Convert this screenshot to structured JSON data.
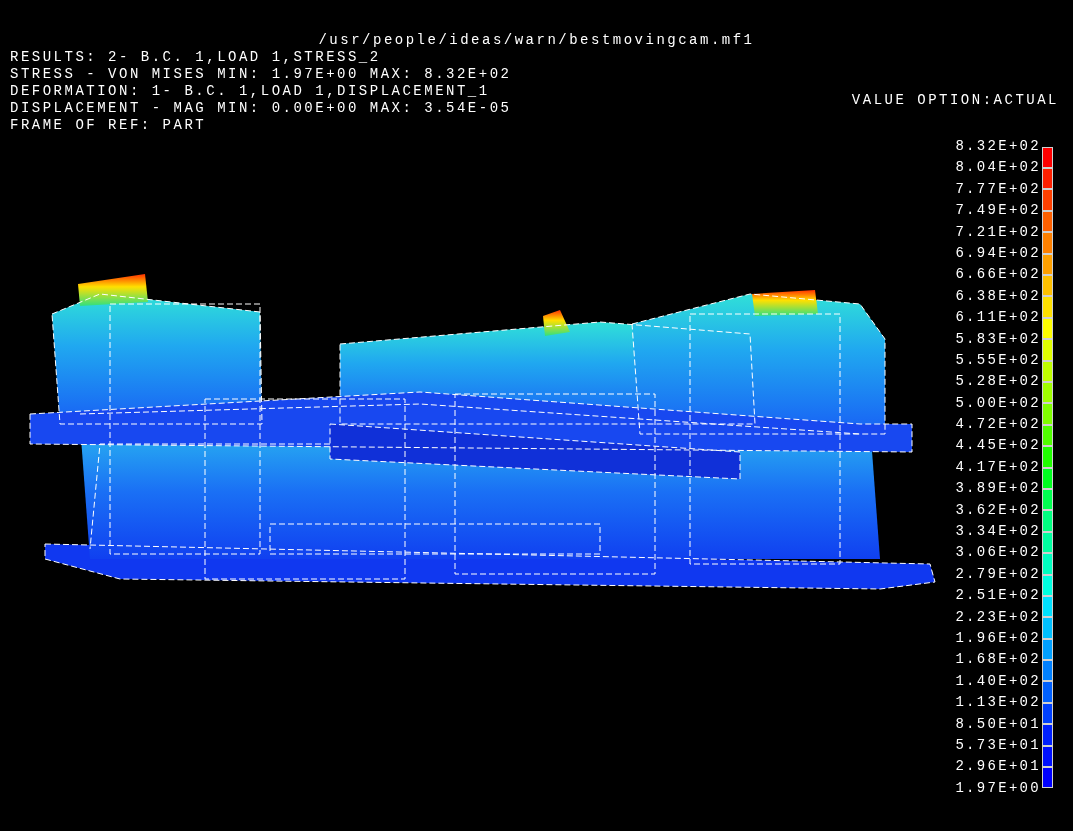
{
  "window": {
    "title": "/usr/people/ideas/warn/bestmovingcam.mf1"
  },
  "info_lines": [
    "RESULTS: 2- B.C. 1,LOAD 1,STRESS_2",
    "STRESS - VON MISES MIN: 1.97E+00 MAX: 8.32E+02",
    "DEFORMATION: 1- B.C. 1,LOAD 1,DISPLACEMENT_1",
    "DISPLACEMENT - MAG MIN: 0.00E+00 MAX: 3.54E-05",
    "FRAME OF REF: PART"
  ],
  "value_option": "VALUE OPTION:ACTUAL",
  "legend": {
    "labels": [
      "8.32E+02",
      "8.04E+02",
      "7.77E+02",
      "7.49E+02",
      "7.21E+02",
      "6.94E+02",
      "6.66E+02",
      "6.38E+02",
      "6.11E+02",
      "5.83E+02",
      "5.55E+02",
      "5.28E+02",
      "5.00E+02",
      "4.72E+02",
      "4.45E+02",
      "4.17E+02",
      "3.89E+02",
      "3.62E+02",
      "3.34E+02",
      "3.06E+02",
      "2.79E+02",
      "2.51E+02",
      "2.23E+02",
      "1.96E+02",
      "1.68E+02",
      "1.40E+02",
      "1.13E+02",
      "8.50E+01",
      "5.73E+01",
      "2.96E+01",
      "1.97E+00"
    ],
    "bands": [
      {
        "color": "#ff0000"
      },
      {
        "color": "#ff2000"
      },
      {
        "color": "#ff4000"
      },
      {
        "color": "#ff6000"
      },
      {
        "color": "#ff8000"
      },
      {
        "color": "#ffa000"
      },
      {
        "color": "#ffc000"
      },
      {
        "color": "#ffe000"
      },
      {
        "color": "#ffff00"
      },
      {
        "color": "#e0ff00"
      },
      {
        "color": "#c0ff00"
      },
      {
        "color": "#a0ff00"
      },
      {
        "color": "#80ff00"
      },
      {
        "color": "#50ff00"
      },
      {
        "color": "#20ff00"
      },
      {
        "color": "#00ff20"
      },
      {
        "color": "#00ff50"
      },
      {
        "color": "#00ff80"
      },
      {
        "color": "#00ffa0"
      },
      {
        "color": "#00ffc0"
      },
      {
        "color": "#00ffe0"
      },
      {
        "color": "#00e0ff"
      },
      {
        "color": "#00c0ff"
      },
      {
        "color": "#00a0ff"
      },
      {
        "color": "#0080ff"
      },
      {
        "color": "#0060ff"
      },
      {
        "color": "#0040ff"
      },
      {
        "color": "#0020ff"
      },
      {
        "color": "#0010ff"
      },
      {
        "color": "#0000ff"
      }
    ]
  }
}
